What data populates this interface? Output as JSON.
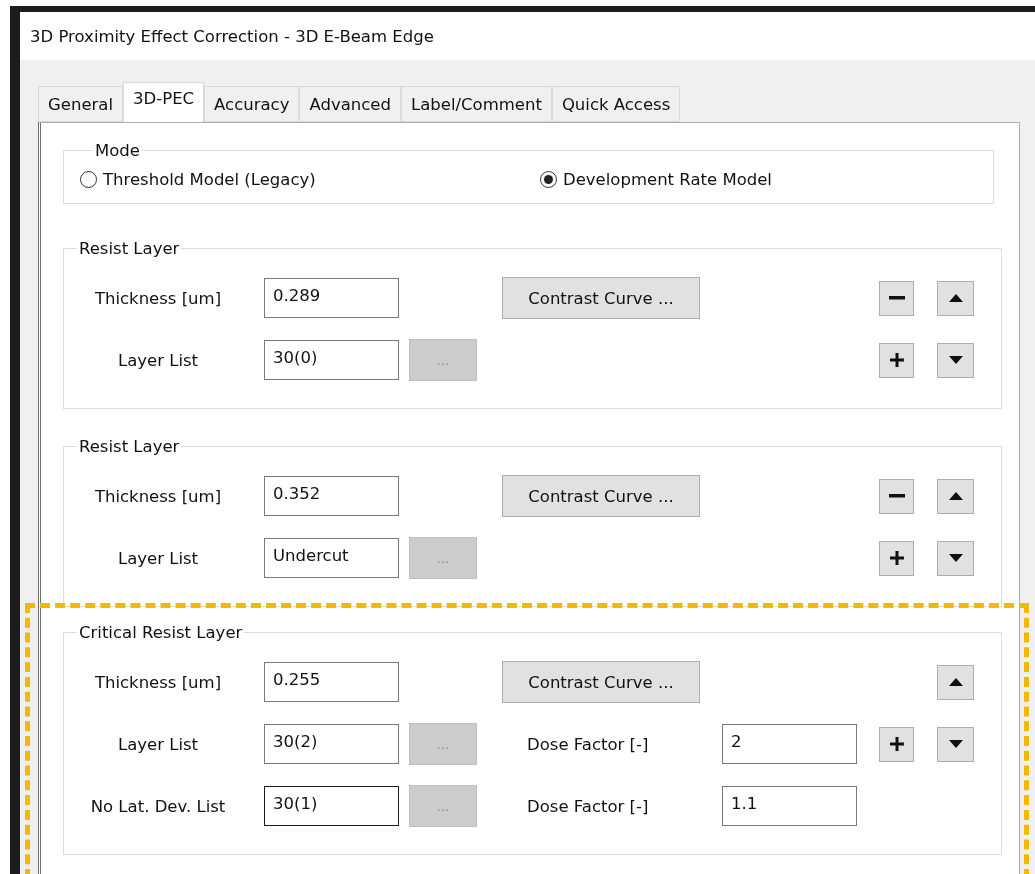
{
  "window": {
    "title": "3D Proximity Effect Correction - 3D E-Beam Edge"
  },
  "tabs": [
    {
      "label": "General",
      "selected": false
    },
    {
      "label": "3D-PEC",
      "selected": true
    },
    {
      "label": "Accuracy",
      "selected": false
    },
    {
      "label": "Advanced",
      "selected": false
    },
    {
      "label": "Label/Comment",
      "selected": false
    },
    {
      "label": "Quick Access",
      "selected": false
    }
  ],
  "mode": {
    "title": "Mode",
    "options": [
      {
        "label": "Threshold Model (Legacy)",
        "selected": false
      },
      {
        "label": "Development Rate Model",
        "selected": true
      }
    ]
  },
  "groups": [
    {
      "title": "Resist Layer",
      "highlighted": false,
      "contrast_button": "Contrast Curve ...",
      "side_buttons": [
        {
          "kind": "remove"
        },
        {
          "kind": "up"
        },
        {
          "kind": "add"
        },
        {
          "kind": "down"
        }
      ],
      "rows": [
        {
          "label": "Thickness [um]",
          "value": "0.289",
          "focused": false
        },
        {
          "label": "Layer List",
          "value": "30(0)",
          "focused": false,
          "browse": {
            "label": "...",
            "disabled": true
          }
        }
      ]
    },
    {
      "title": "Resist Layer",
      "highlighted": false,
      "contrast_button": "Contrast Curve ...",
      "side_buttons": [
        {
          "kind": "remove"
        },
        {
          "kind": "up"
        },
        {
          "kind": "add"
        },
        {
          "kind": "down"
        }
      ],
      "rows": [
        {
          "label": "Thickness [um]",
          "value": "0.352",
          "focused": false
        },
        {
          "label": "Layer List",
          "value": "Undercut",
          "focused": false,
          "browse": {
            "label": "...",
            "disabled": true
          }
        }
      ]
    },
    {
      "title": "Critical Resist Layer",
      "highlighted": true,
      "contrast_button": "Contrast Curve ...",
      "side_buttons": [
        {
          "kind": "up"
        },
        {
          "kind": "add"
        },
        {
          "kind": "down"
        }
      ],
      "rows": [
        {
          "label": "Thickness [um]",
          "value": "0.255",
          "focused": false
        },
        {
          "label": "Layer List",
          "value": "30(2)",
          "focused": false,
          "browse": {
            "label": "...",
            "disabled": true
          },
          "dose": {
            "label": "Dose Factor [-]",
            "value": "2"
          }
        },
        {
          "label": "No Lat. Dev. List",
          "value": "30(1)",
          "focused": true,
          "browse": {
            "label": "...",
            "disabled": true
          },
          "dose": {
            "label": "Dose Factor [-]",
            "value": "1.1"
          }
        }
      ]
    }
  ]
}
